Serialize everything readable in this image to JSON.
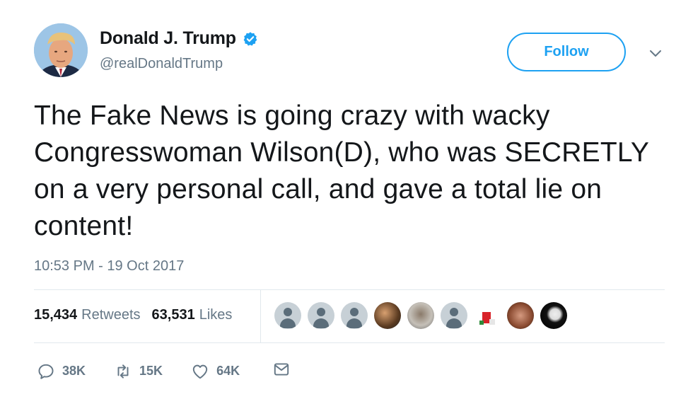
{
  "user": {
    "name": "Donald J. Trump",
    "handle": "@realDonaldTrump",
    "verified": true
  },
  "header": {
    "follow_label": "Follow",
    "menu_icon": "chevron-down-icon"
  },
  "tweet": {
    "text": "The Fake News is going crazy with wacky Congresswoman Wilson(D), who was SECRETLY on a very personal call, and gave a total lie on content!",
    "timestamp": "10:53 PM - 19 Oct 2017"
  },
  "stats": {
    "retweets_count": "15,434",
    "retweets_label": "Retweets",
    "likes_count": "63,531",
    "likes_label": "Likes"
  },
  "likers": [
    "default",
    "default",
    "default",
    "photo",
    "photo",
    "default",
    "photo",
    "photo",
    "photo"
  ],
  "actions": {
    "replies": "38K",
    "retweets": "15K",
    "likes": "64K"
  },
  "colors": {
    "accent": "#1da1f2",
    "text_primary": "#14171a",
    "text_secondary": "#657786",
    "divider": "#e1e8ed"
  }
}
